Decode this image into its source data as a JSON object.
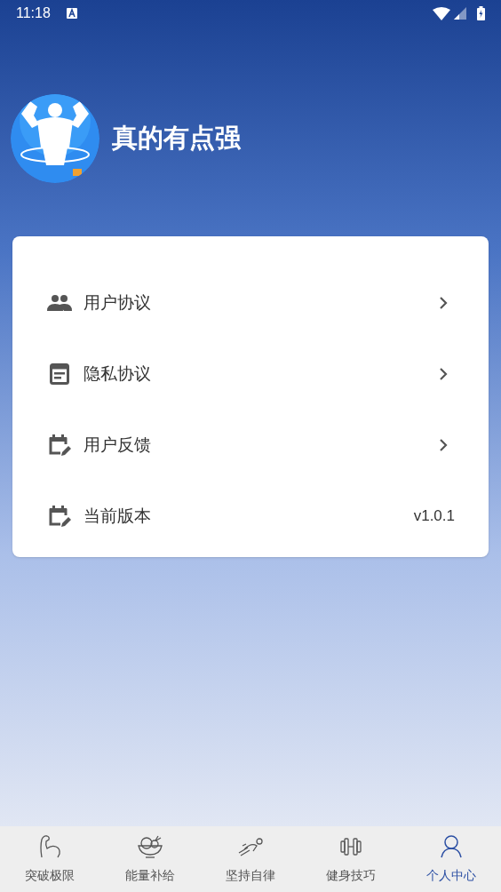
{
  "status_bar": {
    "time": "11:18"
  },
  "profile": {
    "name": "真的有点强"
  },
  "menu": [
    {
      "label": "用户协议",
      "kind": "link"
    },
    {
      "label": "隐私协议",
      "kind": "link"
    },
    {
      "label": "用户反馈",
      "kind": "link"
    },
    {
      "label": "当前版本",
      "kind": "value",
      "value": "v1.0.1"
    }
  ],
  "tabs": [
    {
      "label": "突破极限",
      "selected": false
    },
    {
      "label": "能量补给",
      "selected": false
    },
    {
      "label": "坚持自律",
      "selected": false
    },
    {
      "label": "健身技巧",
      "selected": false
    },
    {
      "label": "个人中心",
      "selected": true
    }
  ]
}
